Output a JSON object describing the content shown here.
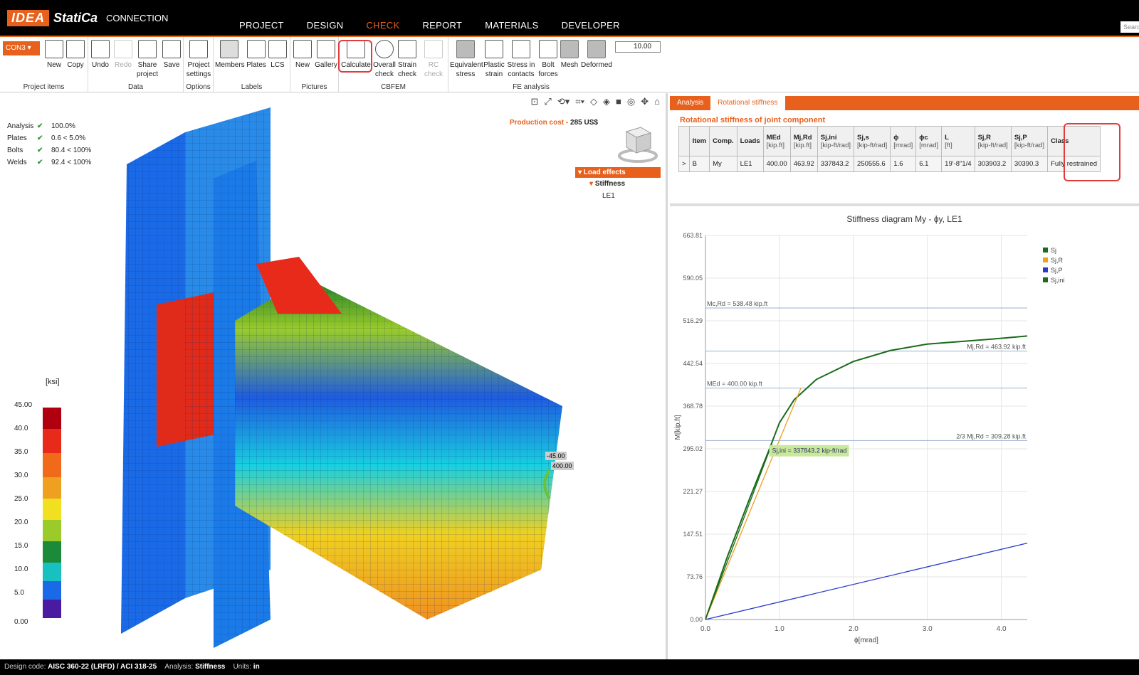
{
  "app": {
    "brand_idea": "IDEA",
    "brand_statica": "StatiCa",
    "product": "CONNECTION"
  },
  "menu": [
    "PROJECT",
    "DESIGN",
    "CHECK",
    "REPORT",
    "MATERIALS",
    "DEVELOPER"
  ],
  "menu_active": "CHECK",
  "search_placeholder": "Searc",
  "ribbon": {
    "connection": "CON3",
    "buttons": {
      "new": "New",
      "copy": "Copy",
      "undo": "Undo",
      "redo": "Redo",
      "share": "Share project",
      "save": "Save",
      "settings": "Project settings",
      "members": "Members",
      "plates": "Plates",
      "lcs": "LCS",
      "pic_new": "New",
      "gallery": "Gallery",
      "calculate": "Calculate",
      "overall": "Overall check",
      "strain": "Strain check",
      "rc": "RC check",
      "equiv": "Equivalent stress",
      "plastic": "Plastic strain",
      "contacts": "Stress in contacts",
      "bolt": "Bolt forces",
      "mesh": "Mesh",
      "deformed": "Deformed"
    },
    "groups": {
      "items": "Project items",
      "data": "Data",
      "options": "Options",
      "labels": "Labels",
      "pictures": "Pictures",
      "cbfem": "CBFEM",
      "fe": "FE analysis"
    },
    "zoom_value": "10.00"
  },
  "checks": [
    {
      "name": "Analysis",
      "value": "100.0%"
    },
    {
      "name": "Plates",
      "value": "0.6 < 5.0%"
    },
    {
      "name": "Bolts",
      "value": "80.4 < 100%"
    },
    {
      "name": "Welds",
      "value": "92.4 < 100%"
    }
  ],
  "cost": {
    "label": "Production cost",
    "value": "285 US$"
  },
  "tree": {
    "root": "Load effects",
    "child": "Stiffness",
    "leaf": "LE1"
  },
  "legend": {
    "unit": "[ksi]",
    "ticks": [
      "45.00",
      "40.0",
      "35.0",
      "30.0",
      "25.0",
      "20.0",
      "15.0",
      "10.0",
      "5.0",
      "0.00"
    ]
  },
  "load_labels": {
    "moment": "-45.00",
    "force": "400.00"
  },
  "panel": {
    "tabs": [
      "Analysis",
      "Rotational stiffness"
    ],
    "title": "Rotational stiffness of joint component",
    "headers": [
      {
        "h": "",
        "u": ""
      },
      {
        "h": "Item",
        "u": ""
      },
      {
        "h": "Comp.",
        "u": ""
      },
      {
        "h": "Loads",
        "u": ""
      },
      {
        "h": "MEd",
        "u": "[kip.ft]"
      },
      {
        "h": "Mj,Rd",
        "u": "[kip.ft]"
      },
      {
        "h": "Sj,ini",
        "u": "[kip-ft/rad]"
      },
      {
        "h": "Sj,s",
        "u": "[kip-ft/rad]"
      },
      {
        "h": "ϕ",
        "u": "[mrad]"
      },
      {
        "h": "ϕc",
        "u": "[mrad]"
      },
      {
        "h": "L",
        "u": "[ft]"
      },
      {
        "h": "Sj,R",
        "u": "[kip-ft/rad]"
      },
      {
        "h": "Sj,P",
        "u": "[kip-ft/rad]"
      },
      {
        "h": "Class",
        "u": ""
      }
    ],
    "row": [
      ">",
      "B",
      "My",
      "LE1",
      "400.00",
      "463.92",
      "337843.2",
      "250555.6",
      "1.6",
      "6.1",
      "19'-8\"1/4",
      "303903.2",
      "30390.3",
      "Fully restrained"
    ]
  },
  "chart_data": {
    "type": "line",
    "title": "Stiffness diagram My - ϕy, LE1",
    "xlabel": "ϕ[mrad]",
    "ylabel": "M[kip.ft]",
    "xlim": [
      0,
      4.35
    ],
    "ylim": [
      0,
      663.81
    ],
    "xticks": [
      "0.0",
      "1.0",
      "2.0",
      "3.0",
      "4.0"
    ],
    "yticks": [
      "0.00",
      "73.76",
      "147.51",
      "221.27",
      "295.02",
      "368.78",
      "442.54",
      "516.29",
      "590.05",
      "663.81"
    ],
    "series": [
      {
        "name": "Sj",
        "color": "#1a6b1a",
        "points": [
          [
            0,
            0
          ],
          [
            0.3,
            110
          ],
          [
            0.6,
            210
          ],
          [
            0.85,
            290
          ],
          [
            1.0,
            340
          ],
          [
            1.2,
            380
          ],
          [
            1.5,
            415
          ],
          [
            2.0,
            446
          ],
          [
            2.5,
            465
          ],
          [
            3.0,
            476
          ],
          [
            3.5,
            481
          ],
          [
            4.0,
            486
          ],
          [
            4.35,
            490
          ]
        ]
      },
      {
        "name": "Sj,R",
        "color": "#f0a020",
        "points": [
          [
            0,
            0
          ],
          [
            1.29,
            400
          ]
        ]
      },
      {
        "name": "Sj,P",
        "color": "#2a3acc",
        "points": [
          [
            0,
            0
          ],
          [
            4.35,
            132
          ]
        ]
      },
      {
        "name": "Sj,ini",
        "color": "#1a6b1a",
        "points": [
          [
            0,
            0
          ],
          [
            0.9,
            304
          ]
        ]
      }
    ],
    "hlines": [
      {
        "y": 538.48,
        "label": "Mc,Rd = 538.48 kip.ft",
        "side": "left"
      },
      {
        "y": 463.92,
        "label": "Mj,Rd = 463.92 kip.ft",
        "side": "right"
      },
      {
        "y": 400.0,
        "label": "MEd = 400.00 kip.ft",
        "side": "left"
      },
      {
        "y": 309.28,
        "label": "2/3 Mj,Rd = 309.28 kip.ft",
        "side": "right"
      }
    ],
    "annotation": "Sj,ini = 337843.2 kip-ft/rad",
    "legend_position": "top-right"
  },
  "status": {
    "code_label": "Design code:",
    "code": "AISC 360-22 (LRFD) / ACI 318-25",
    "analysis_label": "Analysis:",
    "analysis": "Stiffness",
    "units_label": "Units:",
    "units": "in"
  }
}
